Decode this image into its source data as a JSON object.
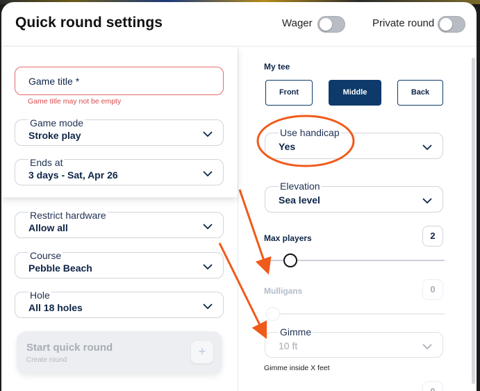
{
  "window": {
    "title": "Quick round settings"
  },
  "header": {
    "wager_label": "Wager",
    "private_label": "Private round",
    "wager_on": false,
    "private_on": false
  },
  "left": {
    "game_title": {
      "placeholder": "Game title *",
      "error": "Game title may not be empty"
    },
    "game_mode": {
      "label": "Game mode",
      "value": "Stroke play"
    },
    "ends_at": {
      "label": "Ends at",
      "value": "3 days - Sat, Apr 26"
    },
    "restrict_hardware": {
      "label": "Restrict hardware",
      "value": "Allow all"
    },
    "course": {
      "label": "Course",
      "value": "Pebble Beach"
    },
    "hole": {
      "label": "Hole",
      "value": "All 18 holes"
    },
    "start": {
      "title": "Start quick round",
      "subtitle": "Create round",
      "plus": "+"
    }
  },
  "right": {
    "my_tee": {
      "label": "My tee",
      "options": [
        "Front",
        "Middle",
        "Back"
      ],
      "selected": "Middle"
    },
    "use_handicap": {
      "label": "Use handicap",
      "value": "Yes"
    },
    "elevation": {
      "label": "Elevation",
      "value": "Sea level"
    },
    "max_players": {
      "label": "Max players",
      "value": "2"
    },
    "mulligans": {
      "label": "Mulligans",
      "value": "0"
    },
    "gimme": {
      "label": "Gimme",
      "value": "10 ft",
      "note": "Gimme inside X feet"
    },
    "next_count": "0"
  },
  "icons": {
    "chevron": "chevron-down-icon",
    "plus": "plus-icon"
  },
  "colors": {
    "primary": "#0d3a6a",
    "error": "#e46a6a",
    "annotation": "#f05a1a"
  }
}
